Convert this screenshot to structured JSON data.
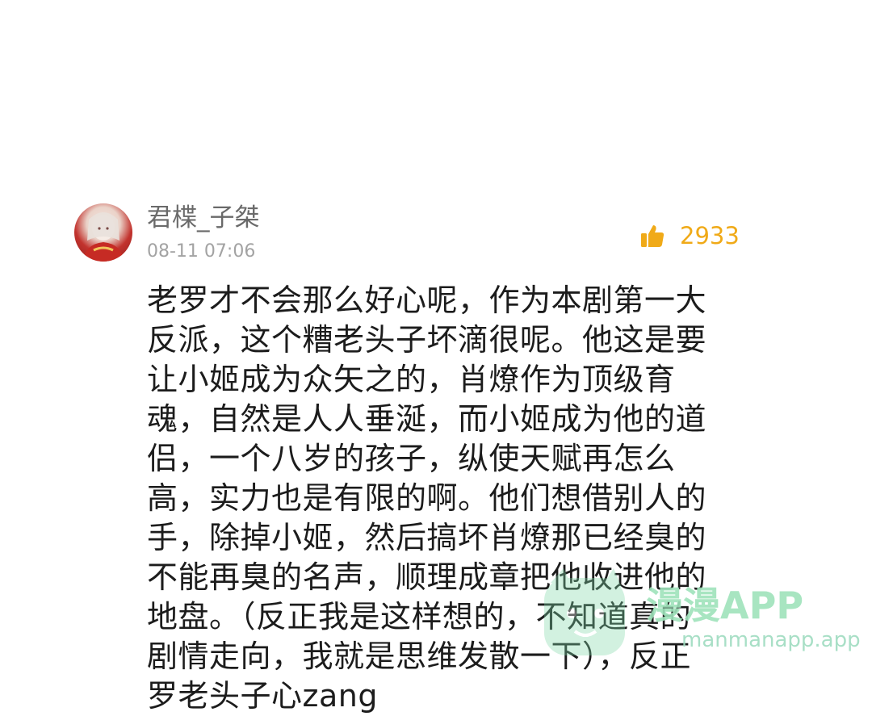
{
  "comment": {
    "username": "君楪_子桀",
    "timestamp": "08-11 07:06",
    "like_count": "2933",
    "body_lines": [
      "老罗才不会那么好心呢，作为本剧第一大",
      "反派，这个糟老头子坏滴很呢。他这是要",
      "让小姬成为众矢之的，肖燎作为顶级育",
      "魂，自然是人人垂涎，而小姬成为他的道",
      "侣，一个八岁的孩子，纵使天赋再怎么",
      "高，实力也是有限的啊。他们想借别人的",
      "手，除掉小姬，然后搞坏肖燎那已经臭的",
      "不能再臭的名声，顺理成章把他收进他的",
      "地盘。（反正我是这样想的，不知道真的",
      "剧情走向，我就是思维发散一下），反正",
      "罗老头子心zang"
    ]
  },
  "watermark": {
    "title": "漫漫APP",
    "url": "manmanapp.app"
  },
  "icons": {
    "like": "thumbs-up-icon",
    "avatar": "user-avatar",
    "watermark_logo": "app-logo-icon"
  },
  "colors": {
    "like_accent": "#f0aa18",
    "username": "#6a6a6a",
    "timestamp": "#a3a3a3",
    "body_text": "#1c1c1c",
    "watermark": "#9fe3bb"
  }
}
